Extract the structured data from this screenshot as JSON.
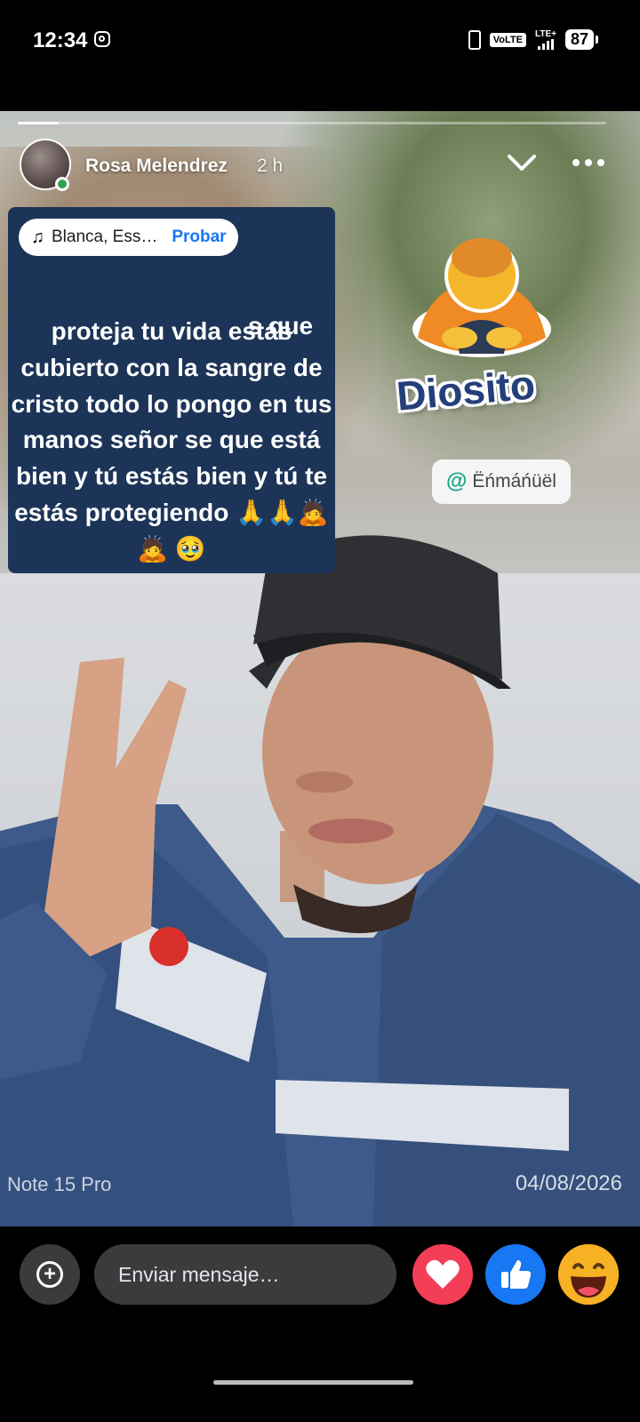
{
  "status_bar": {
    "time": "12:34",
    "volte": "VoLTE",
    "lte": "LTE+",
    "battery": "87"
  },
  "story": {
    "progress": 0.07,
    "author": "Rosa Melendrez",
    "time_ago": "2 h",
    "text_top": "s que",
    "text_body": "proteja tu vida estás cubierto con la sangre de cristo todo lo pongo en tus manos señor se que está bien y tú estás bien y tú te estás protegiendo 🙏🙏🙇🙇 🥹",
    "music": {
      "title": "Blanca, Ess…",
      "action": "Probar"
    },
    "sticker_text": "Diosito",
    "mention": "Ëńmáńüël",
    "watermark_device": "Note 15 Pro",
    "watermark_date": "04/08/2026"
  },
  "bottom_bar": {
    "message_placeholder": "Enviar mensaje…"
  },
  "colors": {
    "text_box_bg": "#1c3457",
    "accent_blue": "#1877f2",
    "love_red": "#f33e58",
    "online_green": "#31a24c"
  },
  "icons": [
    "instagram-icon",
    "vibrate-icon",
    "signal-icon",
    "battery-icon",
    "chevron-down-icon",
    "more-icon",
    "music-note-icon",
    "add-icon",
    "love-icon",
    "like-icon",
    "haha-icon"
  ]
}
